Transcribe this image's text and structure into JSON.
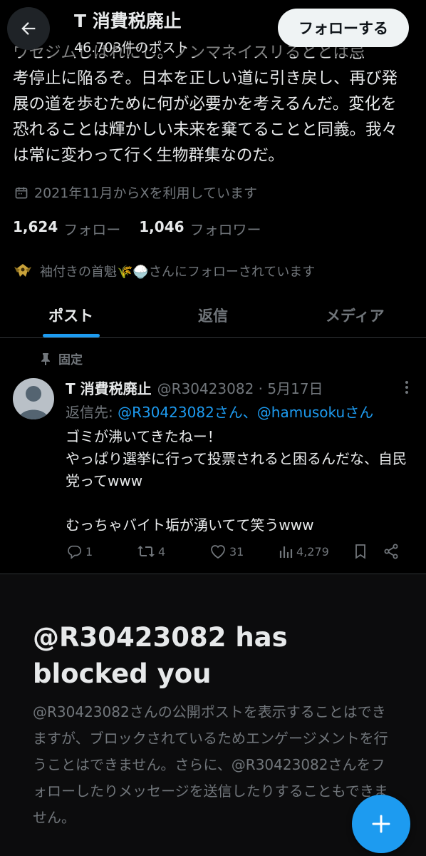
{
  "header": {
    "name": "T 消費税廃止",
    "post_count": "46.703件のポスト",
    "follow_label": "フォローする"
  },
  "profile": {
    "bio_lines": [
      "ワセジムしはれにし。ノンマネイスリるととは忌",
      "考停止に陥るぞ。日本を正しい道に引き戻し、再び発",
      "展の道を歩むために何が必要かを考えるんだ。変化を",
      "恐れることは輝かしい未来を棄てることと同義。我々",
      "は常に変わって行く生物群集なのだ。"
    ],
    "joined": "2021年11月からXを利用しています",
    "following_count": "1,624",
    "following_label": "フォロー",
    "followers_count": "1,046",
    "followers_label": "フォロワー",
    "followed_by": "袖付きの首魁🌾🍚さんにフォローされています"
  },
  "tabs": [
    {
      "label": "ポスト",
      "active": true
    },
    {
      "label": "返信",
      "active": false
    },
    {
      "label": "メディア",
      "active": false
    }
  ],
  "pinned_post": {
    "pinned_label": "固定",
    "author_name": "T 消費税廃止",
    "handle_date": "@R30423082 · 5月17日",
    "reply_prefix": "返信先: ",
    "reply_mentions": "@R30423082さん、@hamusokuさん",
    "body": "ゴミが沸いてきたねー！\nやっぱり選挙に行って投票されると困るんだな、自民党ってwww\n\nむっちゃバイト垢が湧いてて笑うwww",
    "replies": "1",
    "reposts": "4",
    "likes": "31",
    "views": "4,279"
  },
  "blocked": {
    "title": "@R30423082 has blocked you",
    "description": "@R30423082さんの公開ポストを表示することはできますが、ブロックされているためエンゲージメントを行うことはできません。さらに、@R30423082さんをフォローしたりメッセージを送信したりすることもできません。"
  },
  "colors": {
    "accent": "#1d9bf0",
    "muted": "#71767b",
    "text": "#e7e9ea",
    "background": "#000000"
  },
  "icons": [
    "back-arrow-icon",
    "calendar-icon",
    "pin-icon",
    "more-icon",
    "reply-icon",
    "repost-icon",
    "like-icon",
    "views-icon",
    "bookmark-icon",
    "share-icon",
    "plus-icon"
  ]
}
